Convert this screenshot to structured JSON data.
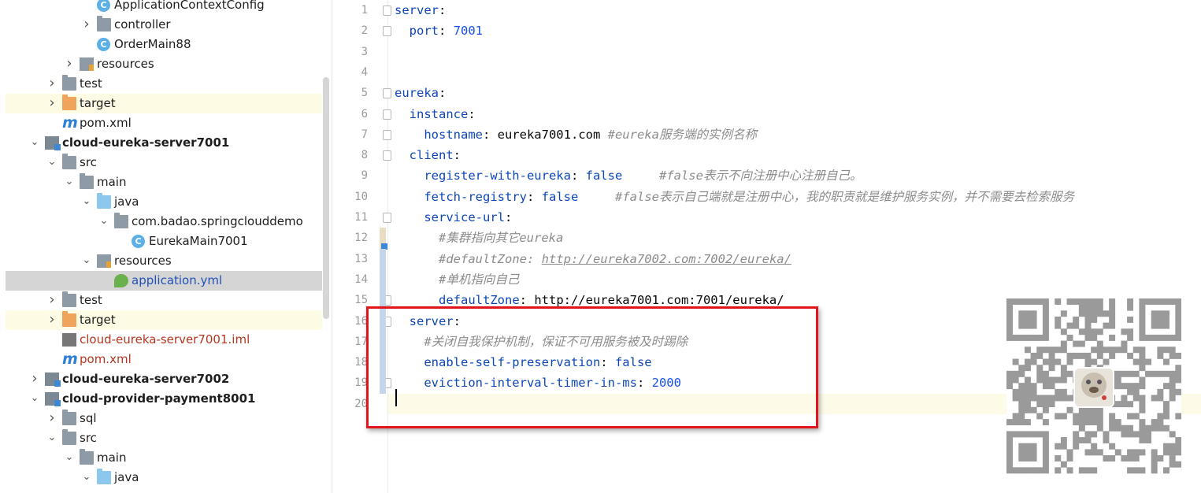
{
  "project_tree": {
    "rows": [
      {
        "indent": 3,
        "arrow": "",
        "icon": "class-icon",
        "label": "ApplicationContextConfig",
        "style": ""
      },
      {
        "indent": 3,
        "arrow": "right",
        "icon": "package-icon",
        "label": "controller",
        "style": ""
      },
      {
        "indent": 3,
        "arrow": "",
        "icon": "spring-class-icon",
        "label": "OrderMain88",
        "style": ""
      },
      {
        "indent": 2,
        "arrow": "right",
        "icon": "resources-folder-icon",
        "label": "resources",
        "style": ""
      },
      {
        "indent": 1,
        "arrow": "right",
        "icon": "folder-icon",
        "label": "test",
        "style": ""
      },
      {
        "indent": 1,
        "arrow": "right",
        "icon": "excluded-folder-icon",
        "label": "target",
        "style": "excl"
      },
      {
        "indent": 1,
        "arrow": "",
        "icon": "maven-icon",
        "label": "pom.xml",
        "style": ""
      },
      {
        "indent": 0,
        "arrow": "down",
        "icon": "module-icon",
        "label": "cloud-eureka-server7001",
        "style": "bold"
      },
      {
        "indent": 1,
        "arrow": "down",
        "icon": "folder-icon",
        "label": "src",
        "style": ""
      },
      {
        "indent": 2,
        "arrow": "down",
        "icon": "folder-icon",
        "label": "main",
        "style": ""
      },
      {
        "indent": 3,
        "arrow": "down",
        "icon": "source-folder-icon",
        "label": "java",
        "style": ""
      },
      {
        "indent": 4,
        "arrow": "down",
        "icon": "package-icon",
        "label": "com.badao.springclouddemo",
        "style": ""
      },
      {
        "indent": 5,
        "arrow": "",
        "icon": "spring-class-icon",
        "label": "EurekaMain7001",
        "style": ""
      },
      {
        "indent": 3,
        "arrow": "down",
        "icon": "resources-folder-icon",
        "label": "resources",
        "style": ""
      },
      {
        "indent": 4,
        "arrow": "",
        "icon": "yaml-icon",
        "label": "application.yml",
        "style": "sel"
      },
      {
        "indent": 1,
        "arrow": "right",
        "icon": "folder-icon",
        "label": "test",
        "style": ""
      },
      {
        "indent": 1,
        "arrow": "right",
        "icon": "excluded-folder-icon",
        "label": "target",
        "style": "excl"
      },
      {
        "indent": 1,
        "arrow": "",
        "icon": "iml-icon",
        "label": "cloud-eureka-server7001.iml",
        "style": "red"
      },
      {
        "indent": 1,
        "arrow": "",
        "icon": "maven-icon",
        "label": "pom.xml",
        "style": "red"
      },
      {
        "indent": 0,
        "arrow": "right",
        "icon": "module-icon",
        "label": "cloud-eureka-server7002",
        "style": "bold"
      },
      {
        "indent": 0,
        "arrow": "down",
        "icon": "module-icon",
        "label": "cloud-provider-payment8001",
        "style": "bold"
      },
      {
        "indent": 1,
        "arrow": "right",
        "icon": "folder-icon",
        "label": "sql",
        "style": ""
      },
      {
        "indent": 1,
        "arrow": "down",
        "icon": "folder-icon",
        "label": "src",
        "style": ""
      },
      {
        "indent": 2,
        "arrow": "down",
        "icon": "folder-icon",
        "label": "main",
        "style": ""
      },
      {
        "indent": 3,
        "arrow": "down",
        "icon": "source-folder-icon",
        "label": "java",
        "style": ""
      }
    ]
  },
  "editor": {
    "lines": [
      {
        "num": "1",
        "tokens": [
          [
            "k",
            "server"
          ],
          [
            "p",
            ":"
          ]
        ]
      },
      {
        "num": "2",
        "tokens": [
          [
            "p",
            "  "
          ],
          [
            "k",
            "port"
          ],
          [
            "p",
            ": "
          ],
          [
            "n",
            "7001"
          ]
        ]
      },
      {
        "num": "3",
        "tokens": []
      },
      {
        "num": "4",
        "tokens": []
      },
      {
        "num": "5",
        "tokens": [
          [
            "k",
            "eureka"
          ],
          [
            "p",
            ":"
          ]
        ]
      },
      {
        "num": "6",
        "tokens": [
          [
            "p",
            "  "
          ],
          [
            "k",
            "instance"
          ],
          [
            "p",
            ":"
          ]
        ]
      },
      {
        "num": "7",
        "tokens": [
          [
            "p",
            "    "
          ],
          [
            "k",
            "hostname"
          ],
          [
            "p",
            ": eureka7001.com "
          ],
          [
            "c",
            "#eureka服务端的实例名称"
          ]
        ]
      },
      {
        "num": "8",
        "tokens": [
          [
            "p",
            "  "
          ],
          [
            "k",
            "client"
          ],
          [
            "p",
            ":"
          ]
        ]
      },
      {
        "num": "9",
        "tokens": [
          [
            "p",
            "    "
          ],
          [
            "k",
            "register-with-eureka"
          ],
          [
            "p",
            ": "
          ],
          [
            "v",
            "false"
          ],
          [
            "p",
            "     "
          ],
          [
            "c",
            "#false表示不向注册中心注册自己。"
          ]
        ]
      },
      {
        "num": "10",
        "tokens": [
          [
            "p",
            "    "
          ],
          [
            "k",
            "fetch-registry"
          ],
          [
            "p",
            ": "
          ],
          [
            "v",
            "false"
          ],
          [
            "p",
            "     "
          ],
          [
            "c",
            "#false表示自己端就是注册中心，我的职责就是维护服务实例，并不需要去检索服务"
          ]
        ]
      },
      {
        "num": "11",
        "tokens": [
          [
            "p",
            "    "
          ],
          [
            "k",
            "service-url"
          ],
          [
            "p",
            ":"
          ]
        ]
      },
      {
        "num": "12",
        "tokens": [
          [
            "p",
            "      "
          ],
          [
            "c",
            "#集群指向其它eureka"
          ]
        ]
      },
      {
        "num": "13",
        "tokens": [
          [
            "p",
            "      "
          ],
          [
            "c",
            "#defaultZone: "
          ],
          [
            "u",
            "http://eureka7002.com:7002/eureka/"
          ]
        ]
      },
      {
        "num": "14",
        "tokens": [
          [
            "p",
            "      "
          ],
          [
            "c",
            "#单机指向自己"
          ]
        ]
      },
      {
        "num": "15",
        "tokens": [
          [
            "p",
            "      "
          ],
          [
            "k",
            "defaultZone"
          ],
          [
            "p",
            ": http://eureka7001.com:7001/eureka/"
          ]
        ]
      },
      {
        "num": "16",
        "tokens": [
          [
            "p",
            "  "
          ],
          [
            "k",
            "server"
          ],
          [
            "p",
            ":"
          ]
        ]
      },
      {
        "num": "17",
        "tokens": [
          [
            "p",
            "    "
          ],
          [
            "c",
            "#关闭自我保护机制，保证不可用服务被及时踢除"
          ]
        ]
      },
      {
        "num": "18",
        "tokens": [
          [
            "p",
            "    "
          ],
          [
            "k",
            "enable-self-preservation"
          ],
          [
            "p",
            ": "
          ],
          [
            "v",
            "false"
          ]
        ]
      },
      {
        "num": "19",
        "tokens": [
          [
            "p",
            "    "
          ],
          [
            "k",
            "eviction-interval-timer-in-ms"
          ],
          [
            "p",
            ": "
          ],
          [
            "n",
            "2000"
          ]
        ]
      },
      {
        "num": "20",
        "tokens": []
      }
    ]
  },
  "colors": {
    "highlight_box": "#e0161c",
    "keyword": "#0d47b8",
    "comment": "#8c8c8c"
  }
}
